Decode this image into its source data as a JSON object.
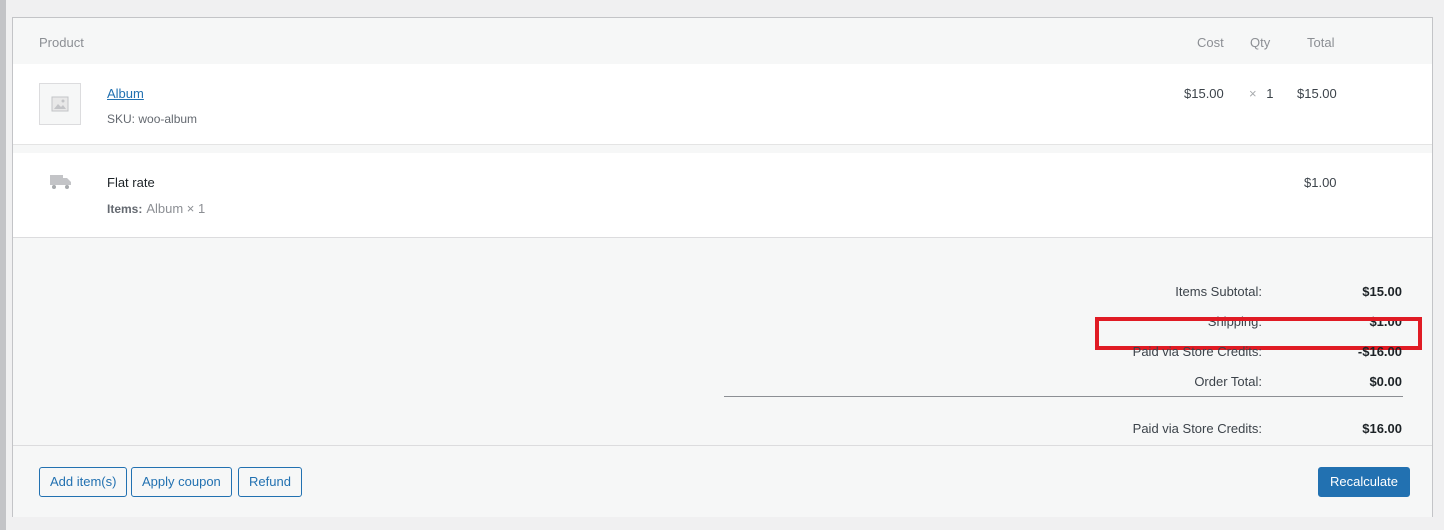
{
  "columns": {
    "product": "Product",
    "cost": "Cost",
    "qty": "Qty",
    "total": "Total"
  },
  "line_item": {
    "name": "Album",
    "sku_label": "SKU:",
    "sku": "woo-album",
    "cost": "$15.00",
    "qty_symbol": "×",
    "qty": "1",
    "total": "$15.00",
    "thumbnail_icon": "image-placeholder-icon"
  },
  "shipping": {
    "name": "Flat rate",
    "items_label": "Items:",
    "items_value": "Album × 1",
    "total": "$1.00",
    "icon": "truck-icon"
  },
  "totals": [
    {
      "label": "Items Subtotal:",
      "value": "$15.00"
    },
    {
      "label": "Shipping:",
      "value": "$1.00"
    },
    {
      "label": "Paid via Store Credits:",
      "value": "-$16.00",
      "highlighted": true
    },
    {
      "label": "Order Total:",
      "value": "$0.00"
    },
    {
      "label": "Paid via Store Credits:",
      "value": "$16.00"
    }
  ],
  "actions": {
    "add_items": "Add item(s)",
    "apply_coupon": "Apply coupon",
    "refund": "Refund",
    "recalculate": "Recalculate"
  },
  "colors": {
    "accent": "#2271b1",
    "highlight": "#e01b24"
  }
}
